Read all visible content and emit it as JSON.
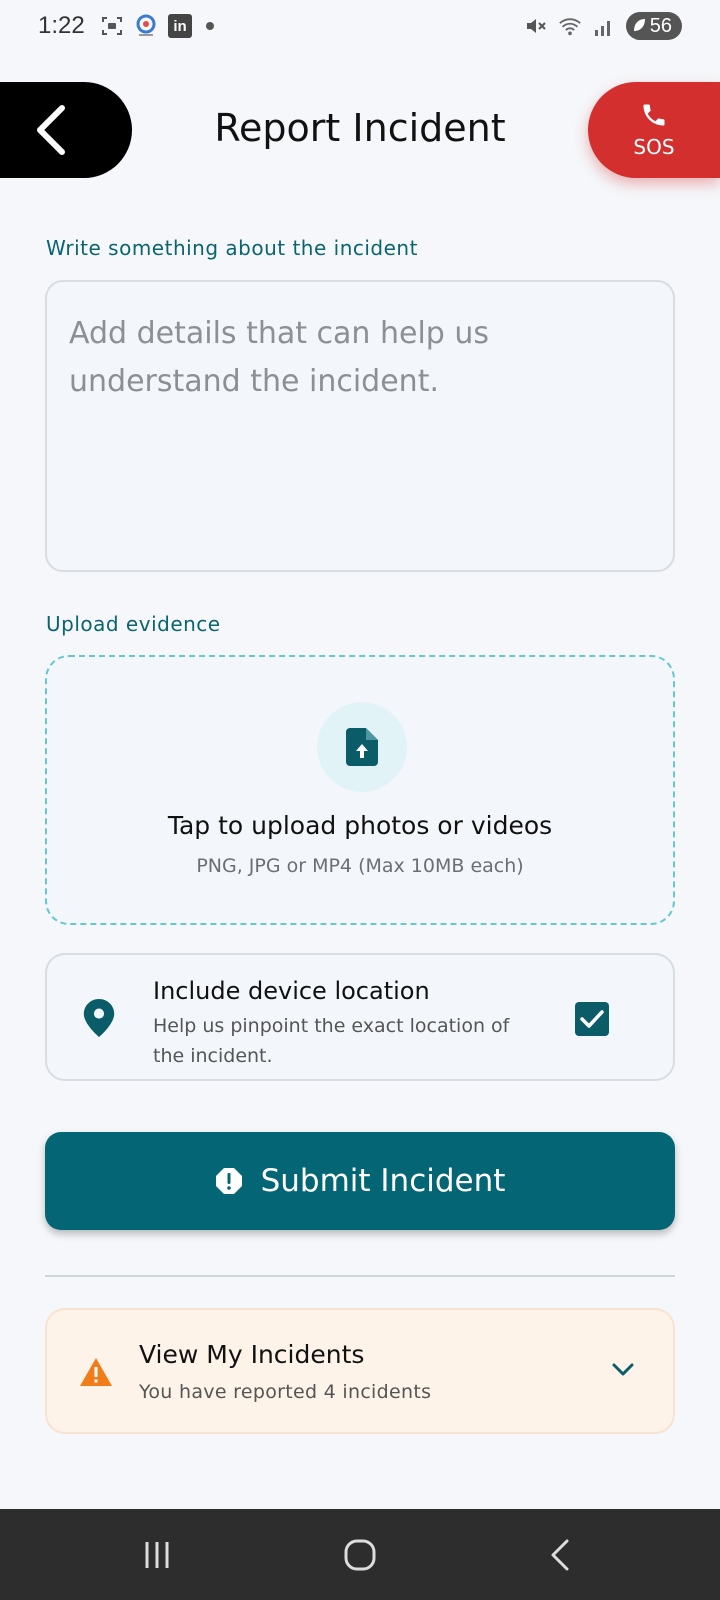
{
  "status_bar": {
    "time": "1:22",
    "battery": "56"
  },
  "header": {
    "title": "Report Incident",
    "sos_label": "SOS"
  },
  "description": {
    "label": "Write something about the incident",
    "placeholder": "Add details that can help us understand the incident."
  },
  "upload": {
    "label": "Upload evidence",
    "title": "Tap to upload photos or videos",
    "subtitle": "PNG, JPG or MP4 (Max 10MB each)"
  },
  "location": {
    "title": "Include device location",
    "subtitle": "Help us pinpoint the exact location of the incident.",
    "checked": true
  },
  "submit": {
    "label": "Submit Incident"
  },
  "incidents": {
    "title": "View My Incidents",
    "subtitle": "You have reported 4 incidents"
  },
  "colors": {
    "accent": "#046675",
    "label": "#0b6470",
    "sos": "#d32f2f",
    "warning": "#f07d1a"
  }
}
